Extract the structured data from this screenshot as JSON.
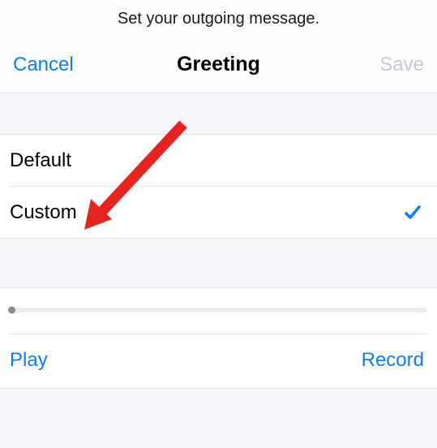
{
  "instruction": "Set your outgoing message.",
  "nav": {
    "cancel": "Cancel",
    "title": "Greeting",
    "save": "Save"
  },
  "options": {
    "default": "Default",
    "custom": "Custom",
    "selected": "custom"
  },
  "controls": {
    "play": "Play",
    "record": "Record"
  },
  "colors": {
    "tint": "#0a7ff5",
    "disabled": "#c9c8ce",
    "background": "#f7f6fa",
    "cell": "#ffffff",
    "arrow": "#e7231f"
  }
}
